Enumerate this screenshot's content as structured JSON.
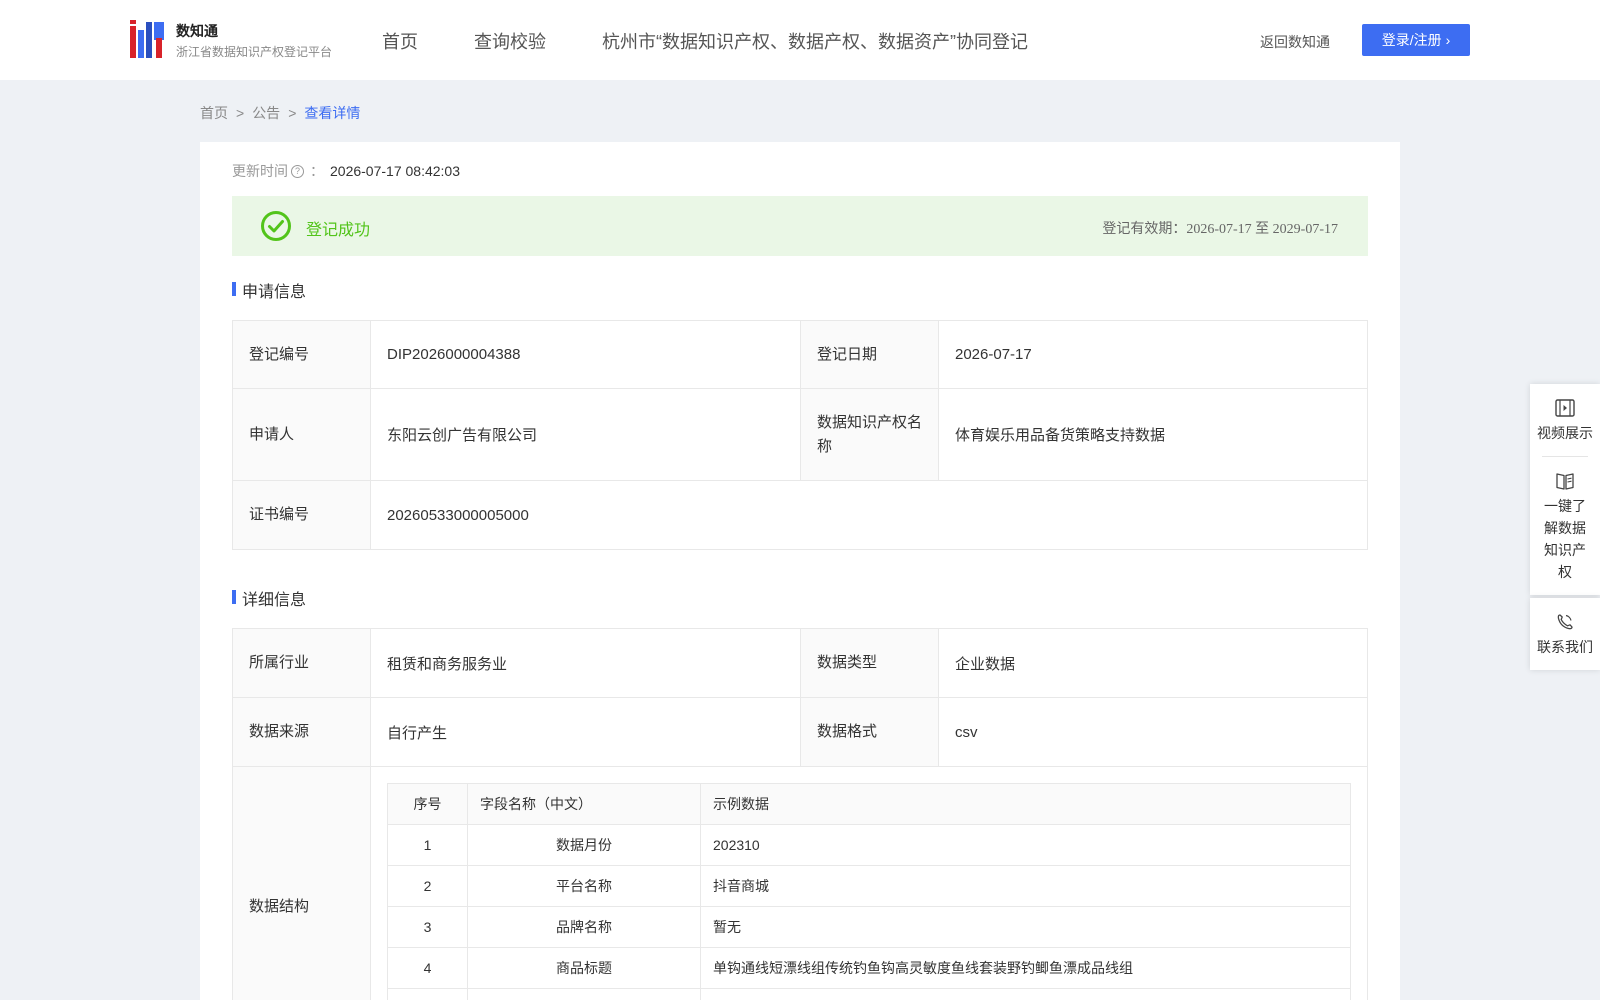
{
  "header": {
    "brand_name": "数知通",
    "brand_sub": "浙江省数据知识产权登记平台",
    "nav": [
      "首页",
      "查询校验",
      "杭州市“数据知识产权、数据产权、数据资产”协同登记"
    ],
    "back_link": "返回数知通",
    "login_label": "登录/注册",
    "accent_color": "#3d6df2"
  },
  "breadcrumb": {
    "items": [
      "首页",
      "公告",
      "查看详情"
    ],
    "separator": ">"
  },
  "update": {
    "label": "更新时间",
    "colon": "：",
    "value": "2026-07-17 08:42:03"
  },
  "status": {
    "text": "登记成功",
    "validity": "登记有效期：2026-07-17 至 2029-07-17",
    "color": "#52c41a"
  },
  "application": {
    "title": "申请信息",
    "reg_no_label": "登记编号",
    "reg_no": "DIP2026000004388",
    "reg_date_label": "登记日期",
    "reg_date": "2026-07-17",
    "applicant_label": "申请人",
    "applicant": "东阳云创广告有限公司",
    "ip_name_label": "数据知识产权名称",
    "ip_name": "体育娱乐用品备货策略支持数据",
    "cert_no_label": "证书编号",
    "cert_no": "20260533000005000"
  },
  "details": {
    "title": "详细信息",
    "industry_label": "所属行业",
    "industry": "租赁和商务服务业",
    "data_type_label": "数据类型",
    "data_type": "企业数据",
    "source_label": "数据来源",
    "source": "自行产生",
    "format_label": "数据格式",
    "format": "csv",
    "structure_label": "数据结构",
    "structure_headers": [
      "序号",
      "字段名称（中文）",
      "示例数据"
    ],
    "structure_rows": [
      [
        "1",
        "数据月份",
        "202310"
      ],
      [
        "2",
        "平台名称",
        "抖音商城"
      ],
      [
        "3",
        "品牌名称",
        "暂无"
      ],
      [
        "4",
        "商品标题",
        "单钩通线短漂线组传统钓鱼钩高灵敏度鱼线套装野钓鲫鱼漂成品线组"
      ]
    ]
  },
  "float_panel": {
    "video": "视频展示",
    "learn": "一键了解数据知识产权",
    "contact": "联系我们"
  }
}
